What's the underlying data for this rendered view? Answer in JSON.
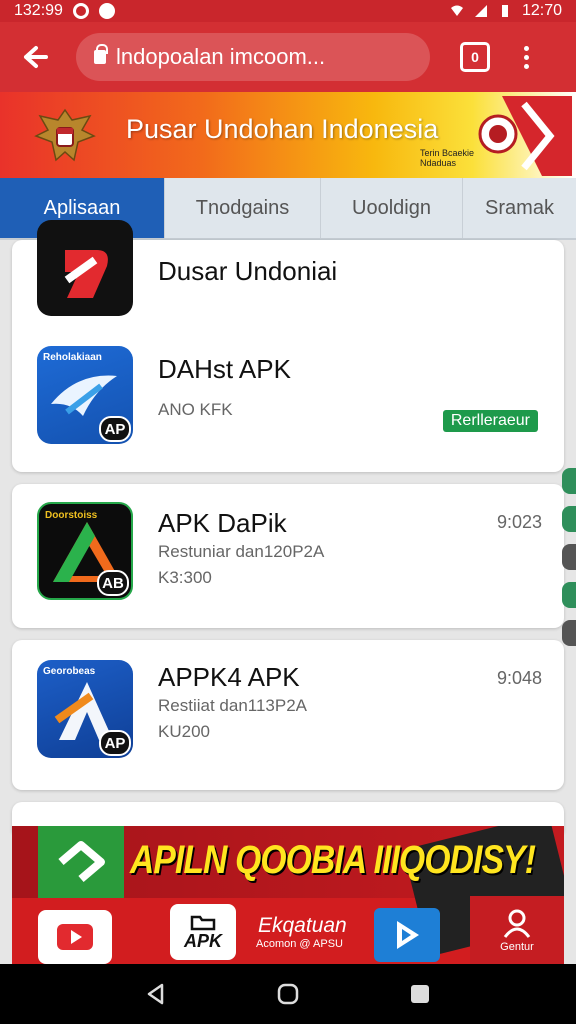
{
  "status_bar": {
    "left_time": "132:99",
    "right_time": "12:70"
  },
  "browser": {
    "url": "lndopoalan imcoom...",
    "tab_count": "0"
  },
  "hero": {
    "title": "Pusar Undohan Indonesia",
    "subtitle": "Terin Bcaekie Ndaduas"
  },
  "tabs": [
    {
      "label": "Aplisaan"
    },
    {
      "label": "Tnodgains"
    },
    {
      "label": "Uooldign"
    },
    {
      "label": "Sramak"
    }
  ],
  "apps": [
    {
      "name": "Dusar Undoniai",
      "sub": "",
      "meta": "",
      "right": ""
    },
    {
      "name": "DAHst APK",
      "sub": "ANO KFK",
      "meta": "",
      "right": "",
      "tag": "Rerlleraeur",
      "icon_label": "Reholakiaan",
      "badge": "AP"
    },
    {
      "name": "APK DaPik",
      "sub": "Restuniar dan120P2A",
      "meta": "K3:300",
      "right": "9:023",
      "icon_label": "Doorstoiss",
      "badge": "AB"
    },
    {
      "name": "APPK4 APK",
      "sub": "Restiiat dan113P2A",
      "meta": "KU200",
      "right": "9:048",
      "icon_label": "Georobeas",
      "badge": "AP"
    }
  ],
  "promo": {
    "title": "APILN QOOBIA IIIQODISY!",
    "apk_label": "APK",
    "download_label": "Ekqatuan",
    "download_sub": "Acomon @ APSU",
    "user_label": "Gentur"
  }
}
